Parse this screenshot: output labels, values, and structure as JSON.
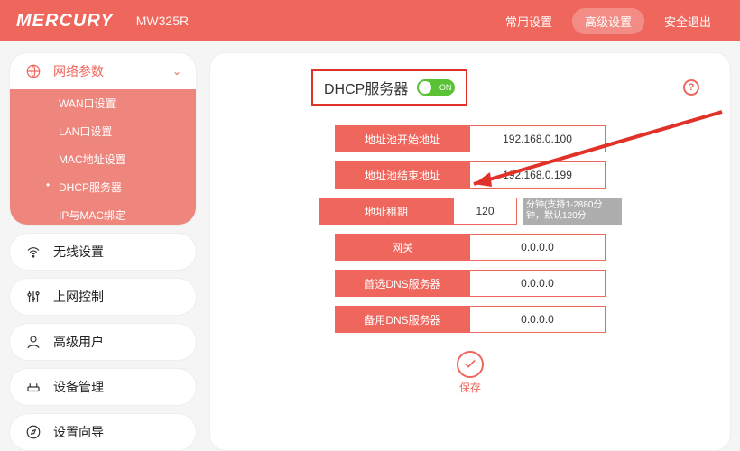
{
  "header": {
    "brand": "MERCURY",
    "model": "MW325R",
    "nav": {
      "common": "常用设置",
      "advanced": "高级设置",
      "logout": "安全退出"
    }
  },
  "sidebar": {
    "network": {
      "label": "网络参数",
      "items": {
        "wan": "WAN口设置",
        "lan": "LAN口设置",
        "mac": "MAC地址设置",
        "dhcp": "DHCP服务器",
        "ipmac": "IP与MAC绑定"
      }
    },
    "wireless": "无线设置",
    "control": "上网控制",
    "advuser": "高级用户",
    "device": "设备管理",
    "wizard": "设置向导"
  },
  "panel": {
    "title": "DHCP服务器",
    "switch_text": "ON",
    "labels": {
      "start": "地址池开始地址",
      "end": "地址池结束地址",
      "lease": "地址租期",
      "gateway": "网关",
      "dns1": "首选DNS服务器",
      "dns2": "备用DNS服务器"
    },
    "values": {
      "start": "192.168.0.100",
      "end": "192.168.0.199",
      "lease": "120",
      "gateway": "0.0.0.0",
      "dns1": "0.0.0.0",
      "dns2": "0.0.0.0"
    },
    "lease_hint": "分钟(支持1-2880分钟，默认120分",
    "save": "保存",
    "help": "?"
  }
}
